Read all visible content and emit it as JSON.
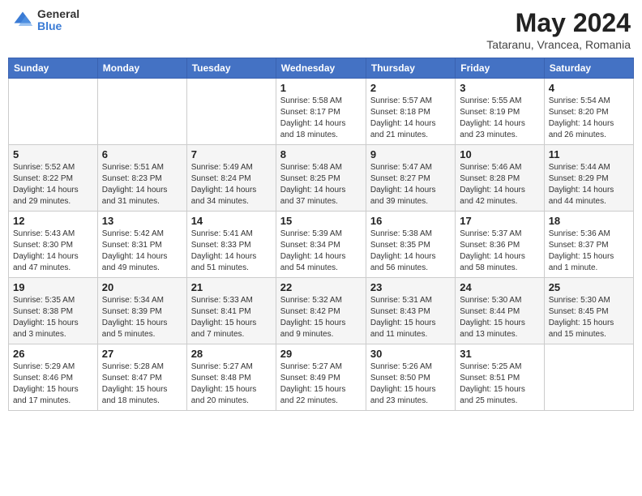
{
  "header": {
    "logo": {
      "general": "General",
      "blue": "Blue"
    },
    "title": "May 2024",
    "location": "Tataranu, Vrancea, Romania"
  },
  "weekdays": [
    "Sunday",
    "Monday",
    "Tuesday",
    "Wednesday",
    "Thursday",
    "Friday",
    "Saturday"
  ],
  "weeks": [
    [
      {
        "day": "",
        "info": ""
      },
      {
        "day": "",
        "info": ""
      },
      {
        "day": "",
        "info": ""
      },
      {
        "day": "1",
        "info": "Sunrise: 5:58 AM\nSunset: 8:17 PM\nDaylight: 14 hours\nand 18 minutes."
      },
      {
        "day": "2",
        "info": "Sunrise: 5:57 AM\nSunset: 8:18 PM\nDaylight: 14 hours\nand 21 minutes."
      },
      {
        "day": "3",
        "info": "Sunrise: 5:55 AM\nSunset: 8:19 PM\nDaylight: 14 hours\nand 23 minutes."
      },
      {
        "day": "4",
        "info": "Sunrise: 5:54 AM\nSunset: 8:20 PM\nDaylight: 14 hours\nand 26 minutes."
      }
    ],
    [
      {
        "day": "5",
        "info": "Sunrise: 5:52 AM\nSunset: 8:22 PM\nDaylight: 14 hours\nand 29 minutes."
      },
      {
        "day": "6",
        "info": "Sunrise: 5:51 AM\nSunset: 8:23 PM\nDaylight: 14 hours\nand 31 minutes."
      },
      {
        "day": "7",
        "info": "Sunrise: 5:49 AM\nSunset: 8:24 PM\nDaylight: 14 hours\nand 34 minutes."
      },
      {
        "day": "8",
        "info": "Sunrise: 5:48 AM\nSunset: 8:25 PM\nDaylight: 14 hours\nand 37 minutes."
      },
      {
        "day": "9",
        "info": "Sunrise: 5:47 AM\nSunset: 8:27 PM\nDaylight: 14 hours\nand 39 minutes."
      },
      {
        "day": "10",
        "info": "Sunrise: 5:46 AM\nSunset: 8:28 PM\nDaylight: 14 hours\nand 42 minutes."
      },
      {
        "day": "11",
        "info": "Sunrise: 5:44 AM\nSunset: 8:29 PM\nDaylight: 14 hours\nand 44 minutes."
      }
    ],
    [
      {
        "day": "12",
        "info": "Sunrise: 5:43 AM\nSunset: 8:30 PM\nDaylight: 14 hours\nand 47 minutes."
      },
      {
        "day": "13",
        "info": "Sunrise: 5:42 AM\nSunset: 8:31 PM\nDaylight: 14 hours\nand 49 minutes."
      },
      {
        "day": "14",
        "info": "Sunrise: 5:41 AM\nSunset: 8:33 PM\nDaylight: 14 hours\nand 51 minutes."
      },
      {
        "day": "15",
        "info": "Sunrise: 5:39 AM\nSunset: 8:34 PM\nDaylight: 14 hours\nand 54 minutes."
      },
      {
        "day": "16",
        "info": "Sunrise: 5:38 AM\nSunset: 8:35 PM\nDaylight: 14 hours\nand 56 minutes."
      },
      {
        "day": "17",
        "info": "Sunrise: 5:37 AM\nSunset: 8:36 PM\nDaylight: 14 hours\nand 58 minutes."
      },
      {
        "day": "18",
        "info": "Sunrise: 5:36 AM\nSunset: 8:37 PM\nDaylight: 15 hours\nand 1 minute."
      }
    ],
    [
      {
        "day": "19",
        "info": "Sunrise: 5:35 AM\nSunset: 8:38 PM\nDaylight: 15 hours\nand 3 minutes."
      },
      {
        "day": "20",
        "info": "Sunrise: 5:34 AM\nSunset: 8:39 PM\nDaylight: 15 hours\nand 5 minutes."
      },
      {
        "day": "21",
        "info": "Sunrise: 5:33 AM\nSunset: 8:41 PM\nDaylight: 15 hours\nand 7 minutes."
      },
      {
        "day": "22",
        "info": "Sunrise: 5:32 AM\nSunset: 8:42 PM\nDaylight: 15 hours\nand 9 minutes."
      },
      {
        "day": "23",
        "info": "Sunrise: 5:31 AM\nSunset: 8:43 PM\nDaylight: 15 hours\nand 11 minutes."
      },
      {
        "day": "24",
        "info": "Sunrise: 5:30 AM\nSunset: 8:44 PM\nDaylight: 15 hours\nand 13 minutes."
      },
      {
        "day": "25",
        "info": "Sunrise: 5:30 AM\nSunset: 8:45 PM\nDaylight: 15 hours\nand 15 minutes."
      }
    ],
    [
      {
        "day": "26",
        "info": "Sunrise: 5:29 AM\nSunset: 8:46 PM\nDaylight: 15 hours\nand 17 minutes."
      },
      {
        "day": "27",
        "info": "Sunrise: 5:28 AM\nSunset: 8:47 PM\nDaylight: 15 hours\nand 18 minutes."
      },
      {
        "day": "28",
        "info": "Sunrise: 5:27 AM\nSunset: 8:48 PM\nDaylight: 15 hours\nand 20 minutes."
      },
      {
        "day": "29",
        "info": "Sunrise: 5:27 AM\nSunset: 8:49 PM\nDaylight: 15 hours\nand 22 minutes."
      },
      {
        "day": "30",
        "info": "Sunrise: 5:26 AM\nSunset: 8:50 PM\nDaylight: 15 hours\nand 23 minutes."
      },
      {
        "day": "31",
        "info": "Sunrise: 5:25 AM\nSunset: 8:51 PM\nDaylight: 15 hours\nand 25 minutes."
      },
      {
        "day": "",
        "info": ""
      }
    ]
  ]
}
